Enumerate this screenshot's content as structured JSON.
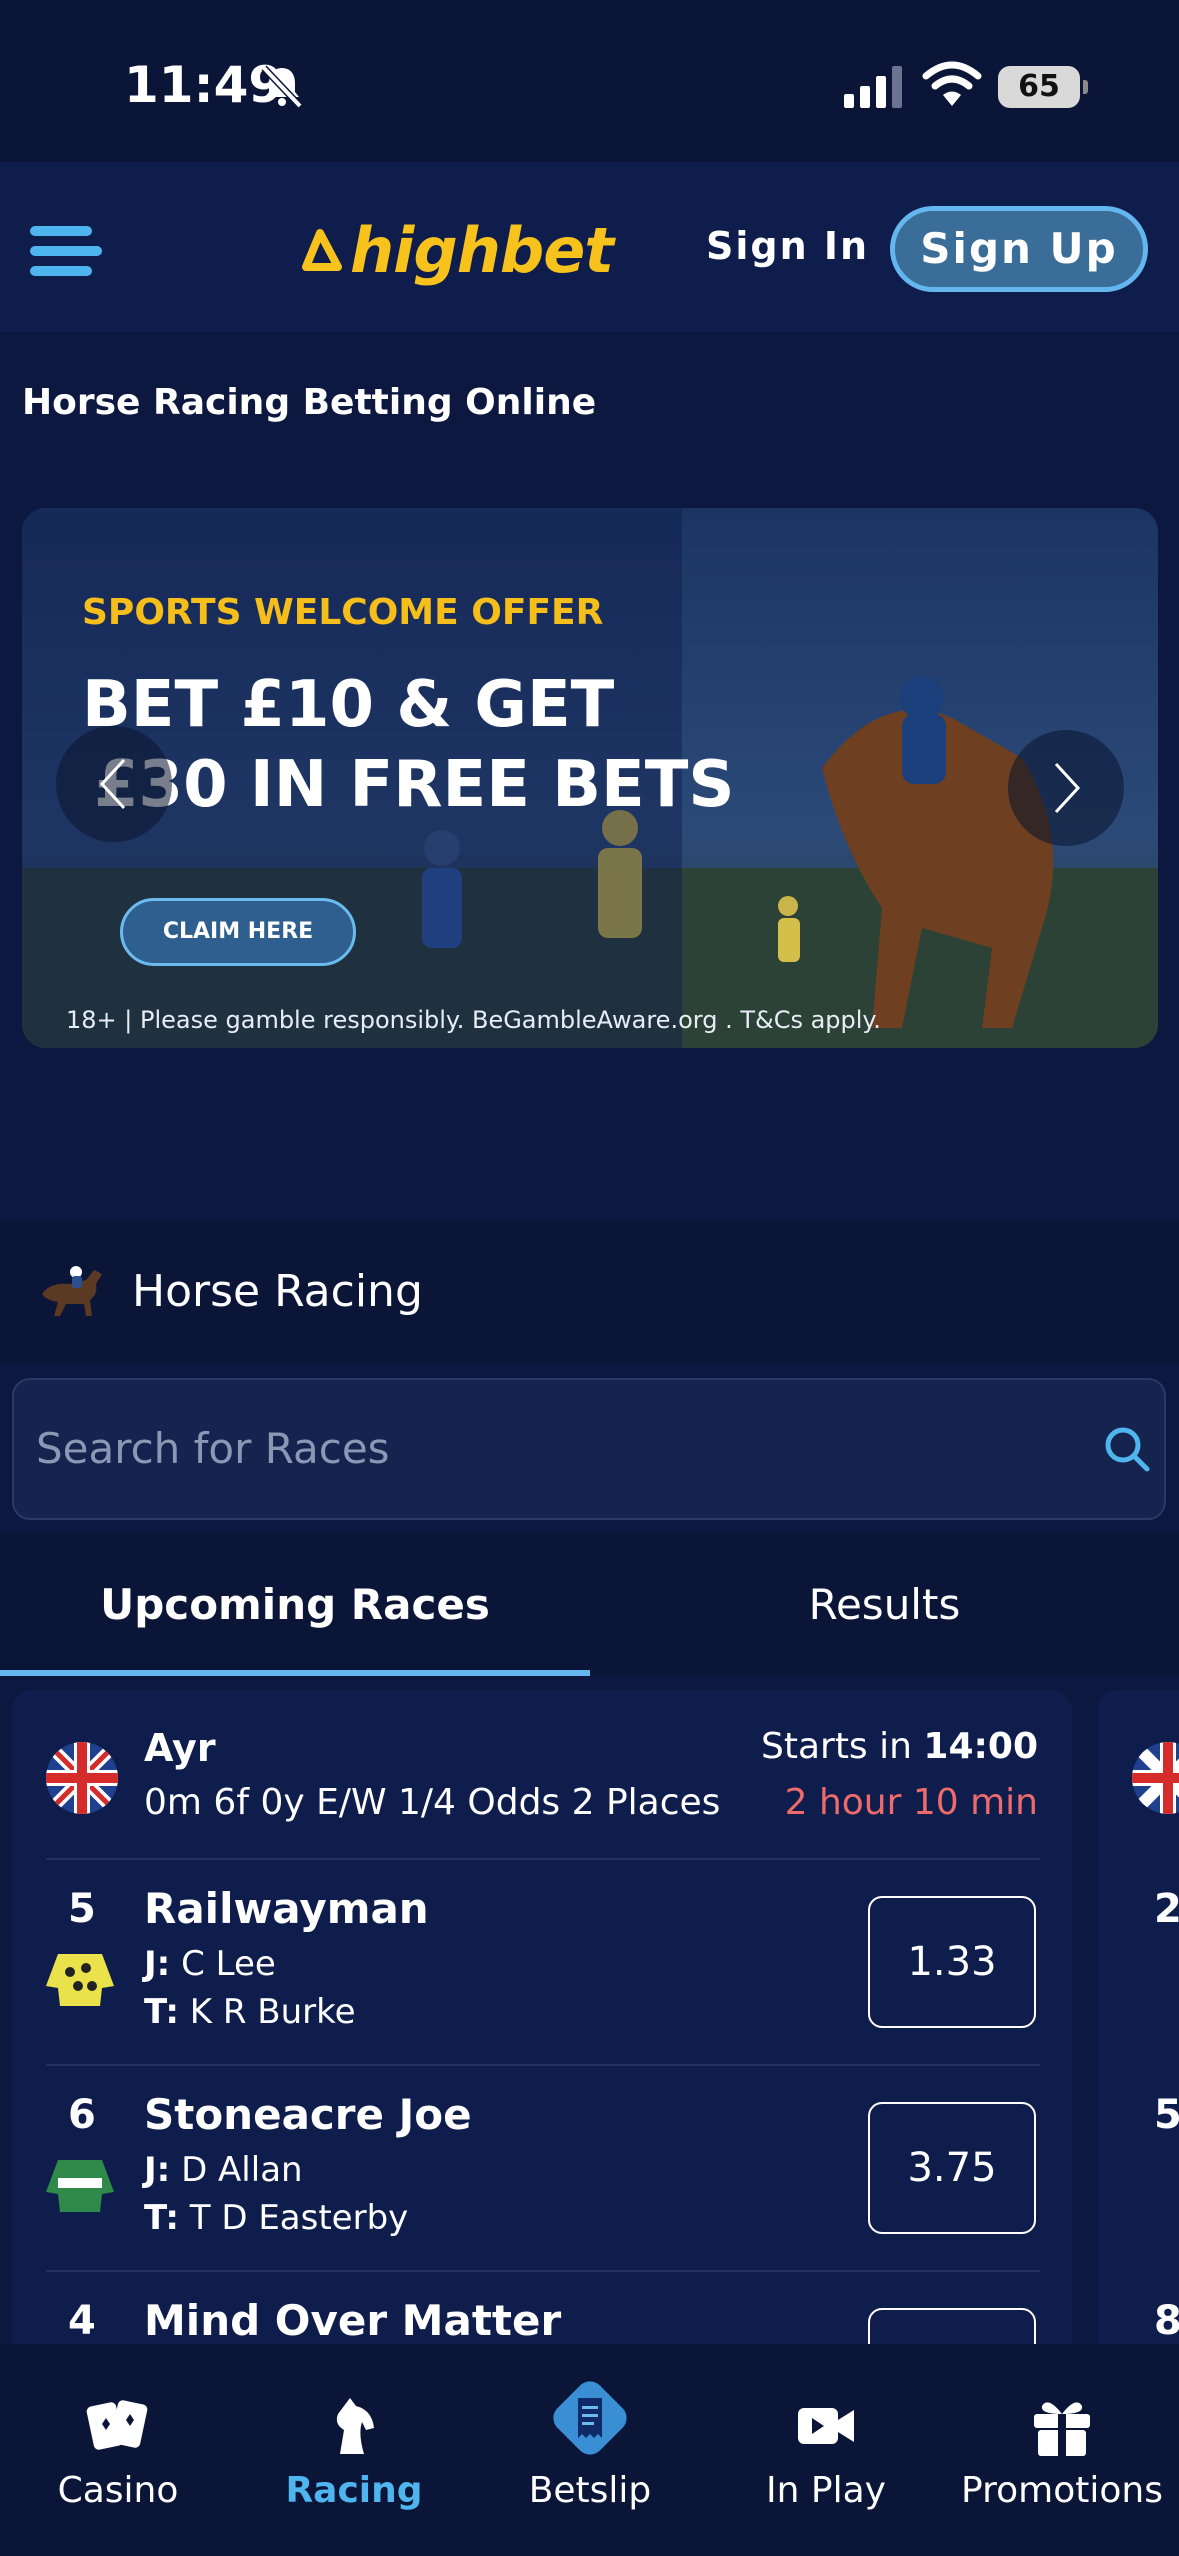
{
  "status_bar": {
    "time": "11:49",
    "battery": "65"
  },
  "header": {
    "logo": "highbet",
    "sign_in": "Sign In",
    "sign_up": "Sign Up"
  },
  "page_title": "Horse Racing Betting Online",
  "banner": {
    "kicker": "SPORTS WELCOME OFFER",
    "headline_1": "BET £10 & GET",
    "headline_2": "£30 IN FREE BETS",
    "cta": "CLAIM HERE",
    "disclaimer": "18+ | Please gamble responsibly. BeGambleAware.org . T&Cs apply."
  },
  "sport": {
    "title": "Horse Racing"
  },
  "search": {
    "placeholder": "Search for Races"
  },
  "tabs": [
    {
      "label": "Upcoming Races",
      "active": true
    },
    {
      "label": "Results",
      "active": false
    }
  ],
  "race": {
    "venue": "Ayr",
    "description": "0m 6f 0y E/W 1/4 Odds 2 Places",
    "starts_in_label": "Starts in",
    "start_time": "14:00",
    "countdown": "2 hour 10 min",
    "runners": [
      {
        "number": "5",
        "name": "Railwayman",
        "jockey_label": "J:",
        "jockey": "C Lee",
        "trainer_label": "T:",
        "trainer": "K R Burke",
        "odds": "1.33"
      },
      {
        "number": "6",
        "name": "Stoneacre Joe",
        "jockey_label": "J:",
        "jockey": "D Allan",
        "trainer_label": "T:",
        "trainer": "T D Easterby",
        "odds": "3.75"
      },
      {
        "number": "4",
        "name": "Mind Over Matter",
        "jockey_label": "J:",
        "jockey": "",
        "trainer_label": "T:",
        "trainer": "",
        "odds": ""
      }
    ]
  },
  "next_card_peek": {
    "numbers": [
      "2",
      "5",
      "8"
    ]
  },
  "bottom_nav": [
    {
      "label": "Casino",
      "icon": "cards-icon",
      "active": false
    },
    {
      "label": "Racing",
      "icon": "horse-head-icon",
      "active": true
    },
    {
      "label": "Betslip",
      "icon": "receipt-icon",
      "active": false
    },
    {
      "label": "In Play",
      "icon": "video-icon",
      "active": false
    },
    {
      "label": "Promotions",
      "icon": "gift-icon",
      "active": false
    }
  ],
  "colors": {
    "accent": "#4fb5ef",
    "brand_yellow": "#f7c21c",
    "countdown_red": "#ef6a6a",
    "background": "#0d1840"
  }
}
